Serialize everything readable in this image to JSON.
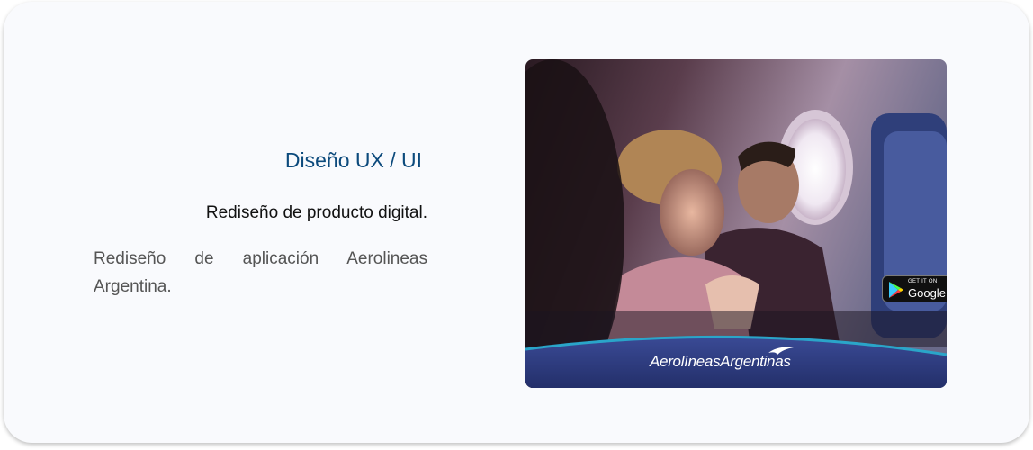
{
  "project": {
    "category": "Diseño UX / UI",
    "subtitle": "Rediseño de producto digital.",
    "description": "Rediseño de aplicación Aerolineas Argentina."
  },
  "image": {
    "badge": {
      "small_text": "GET IT ON",
      "big_text": "Google Play",
      "icon": "google-play-icon"
    },
    "brand_text": "AerolíneasArgentinas",
    "brand_icon": "bird-logo-icon"
  },
  "colors": {
    "card_bg": "#f9fafd",
    "title": "#0c4a7c",
    "subtitle": "#111111",
    "description": "#555555",
    "brand_band": "#2f3e86",
    "brand_band_edge": "#2aa5c9"
  }
}
